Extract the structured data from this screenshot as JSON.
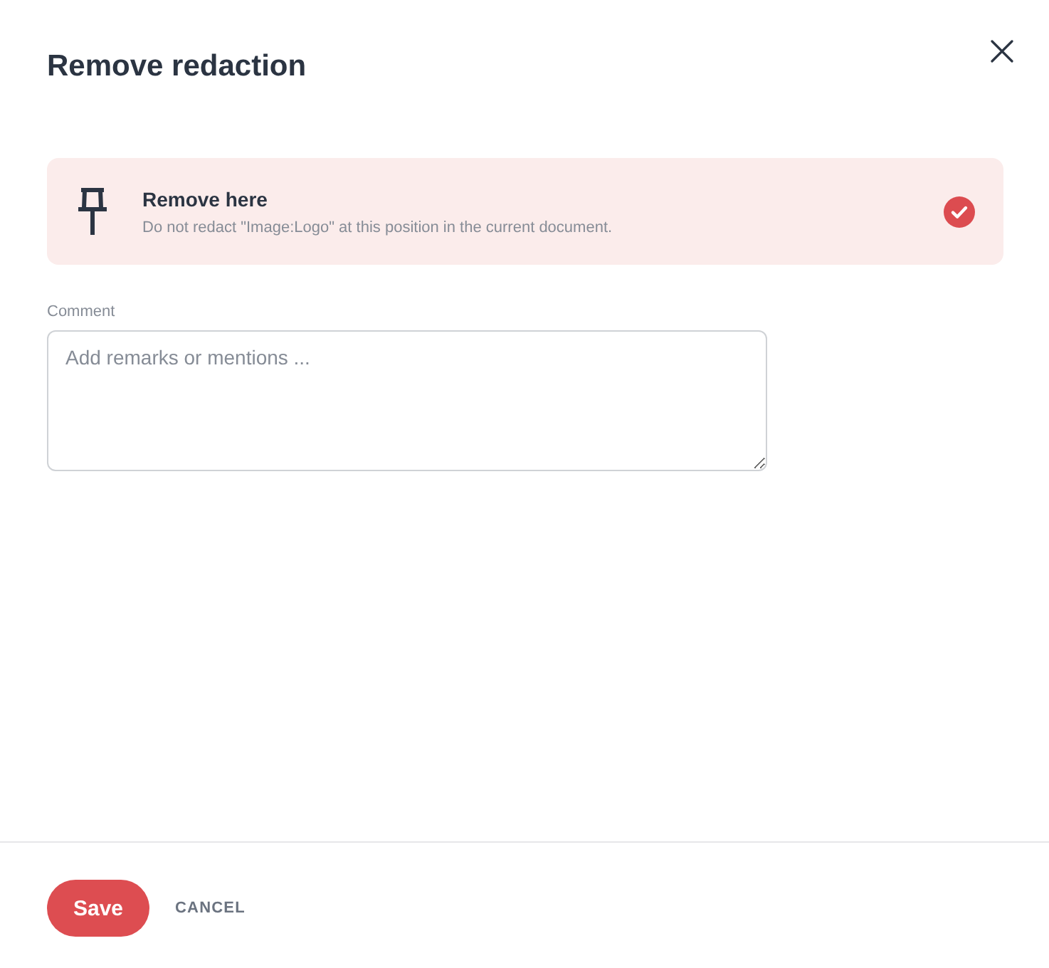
{
  "dialog": {
    "title": "Remove redaction"
  },
  "options": [
    {
      "title": "Remove here",
      "description": "Do not redact \"Image:Logo\" at this position in the current document.",
      "selected": true
    }
  ],
  "comment": {
    "label": "Comment",
    "placeholder": "Add remarks or mentions ..."
  },
  "buttons": [
    {
      "label": "Save",
      "kind": "primary"
    },
    {
      "label": "CANCEL",
      "kind": "text"
    }
  ]
}
